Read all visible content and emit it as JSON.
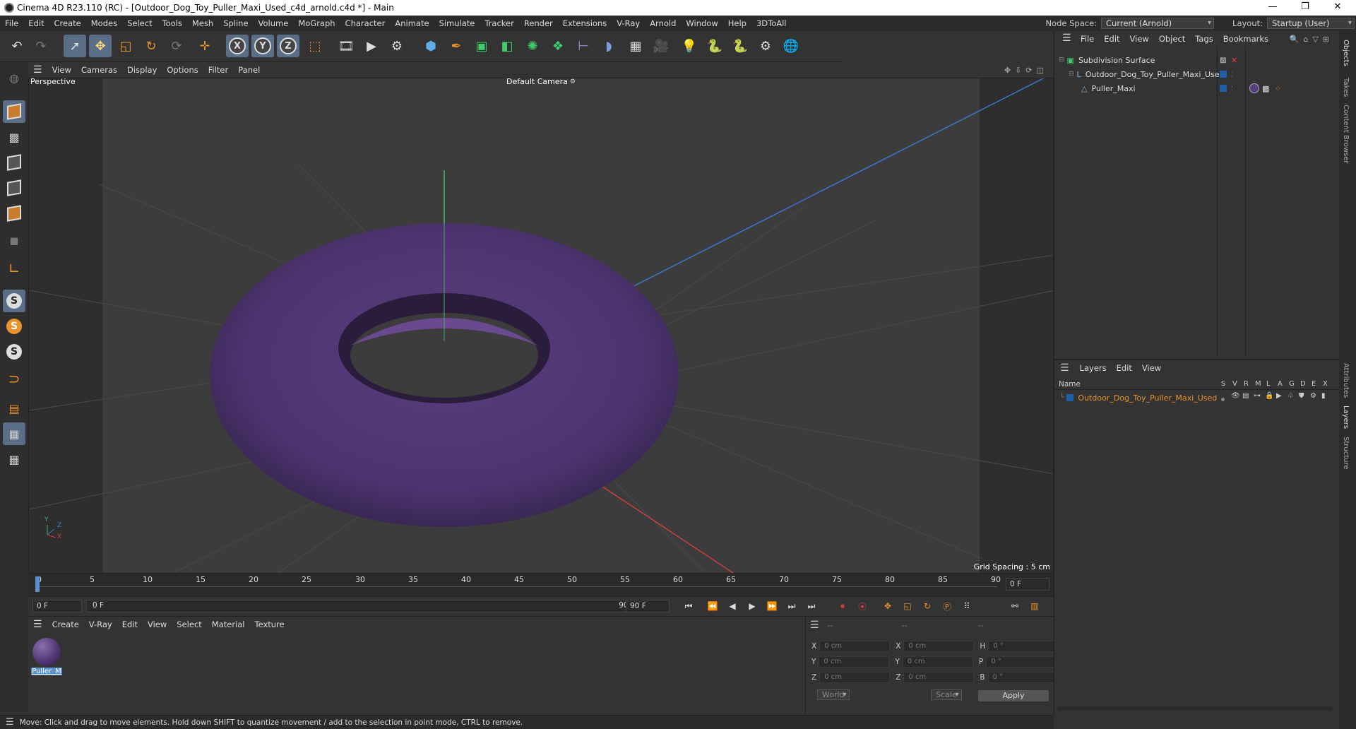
{
  "titlebar": {
    "title": "Cinema 4D R23.110 (RC) - [Outdoor_Dog_Toy_Puller_Maxi_Used_c4d_arnold.c4d *] - Main",
    "minimize": "—",
    "maximize": "❐",
    "close": "✕"
  },
  "menubar": {
    "items": [
      "File",
      "Edit",
      "Create",
      "Modes",
      "Select",
      "Tools",
      "Mesh",
      "Spline",
      "Volume",
      "MoGraph",
      "Character",
      "Animate",
      "Simulate",
      "Tracker",
      "Render",
      "Extensions",
      "V-Ray",
      "Arnold",
      "Window",
      "Help",
      "3DToAll"
    ],
    "node_space_label": "Node Space:",
    "node_space_value": "Current (Arnold)",
    "layout_label": "Layout:",
    "layout_value": "Startup (User)"
  },
  "viewport": {
    "menu": [
      "View",
      "Cameras",
      "Display",
      "Options",
      "Filter",
      "Panel"
    ],
    "label": "Perspective",
    "camera": "Default Camera",
    "camera_icon": "camera-icon",
    "grid_spacing": "Grid Spacing : 5 cm",
    "object_color": "#5a3d7e",
    "axis_labels": {
      "y": "Y",
      "z": "Z",
      "x": "X"
    }
  },
  "timeline": {
    "ticks": [
      "0",
      "5",
      "10",
      "15",
      "20",
      "25",
      "30",
      "35",
      "40",
      "45",
      "50",
      "55",
      "60",
      "65",
      "70",
      "75",
      "80",
      "85",
      "90"
    ],
    "current_frame": "0 F",
    "start_field": "0 F",
    "range_start": "0 F",
    "range_end": "90 F",
    "end_field": "90 F",
    "right_field": "0 F"
  },
  "material_panel": {
    "menu": [
      "Create",
      "V-Ray",
      "Edit",
      "View",
      "Select",
      "Material",
      "Texture"
    ],
    "material_name": "Puller_M"
  },
  "coord_panel": {
    "headers": [
      "--",
      "--",
      "--"
    ],
    "rows": [
      {
        "l1": "X",
        "v1": "0 cm",
        "l2": "X",
        "v2": "0 cm",
        "l3": "H",
        "v3": "0 °"
      },
      {
        "l1": "Y",
        "v1": "0 cm",
        "l2": "Y",
        "v2": "0 cm",
        "l3": "P",
        "v3": "0 °"
      },
      {
        "l1": "Z",
        "v1": "0 cm",
        "l2": "Z",
        "v2": "0 cm",
        "l3": "B",
        "v3": "0 °"
      }
    ],
    "world": "World",
    "scale": "Scale",
    "apply": "Apply"
  },
  "status": {
    "text": "Move: Click and drag to move elements. Hold down SHIFT to quantize movement / add to the selection in point mode, CTRL to remove."
  },
  "object_manager": {
    "menu": [
      "File",
      "Edit",
      "View",
      "Object",
      "Tags",
      "Bookmarks"
    ],
    "objects": [
      {
        "name": "Subdivision Surface"
      },
      {
        "name": "Outdoor_Dog_Toy_Puller_Maxi_Used"
      },
      {
        "name": "Puller_Maxi"
      }
    ]
  },
  "layer_manager": {
    "menu": [
      "Layers",
      "Edit",
      "View"
    ],
    "col_name": "Name",
    "cols": [
      "S",
      "V",
      "R",
      "M",
      "L",
      "A",
      "G",
      "D",
      "E",
      "X"
    ],
    "layers": [
      {
        "name": "Outdoor_Dog_Toy_Puller_Maxi_Used",
        "color": "#e9922b"
      }
    ]
  },
  "side_tabs": [
    "Objects",
    "Takes",
    "Content Browser",
    "Attributes",
    "Layers",
    "Structure"
  ]
}
